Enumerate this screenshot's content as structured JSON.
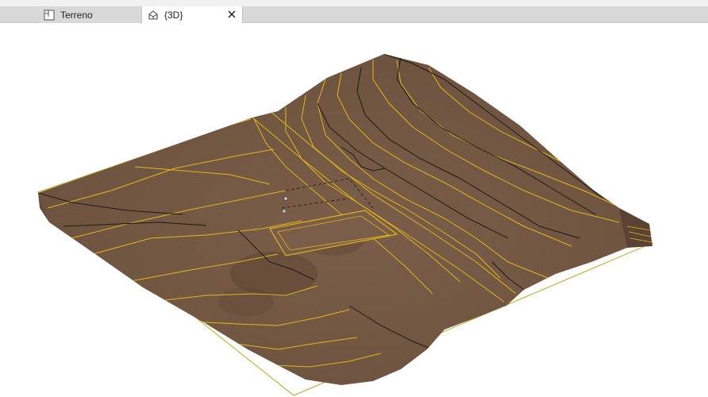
{
  "tabs": [
    {
      "label": "Terreno",
      "icon": "plan-view-icon",
      "active": false
    },
    {
      "label": "{3D}",
      "icon": "3d-view-icon",
      "active": true,
      "closable": true
    }
  ],
  "colors": {
    "terrain": "#6e5441",
    "terrain_shade": "#5a4332",
    "contour_major": "#e2b51b",
    "contour_minor": "#1e1a16",
    "boundary": "#b8a820",
    "tab_active": "#ffffff",
    "tab_inactive": "#d8d8d8"
  }
}
